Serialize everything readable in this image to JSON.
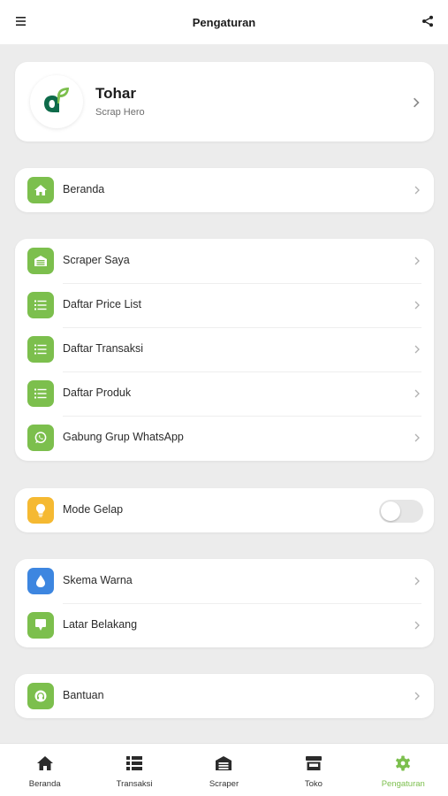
{
  "header": {
    "title": "Pengaturan",
    "menu_icon": "hamburger-menu-icon",
    "share_icon": "share-icon"
  },
  "profile": {
    "name": "Tohar",
    "subtitle": "Scrap Hero",
    "logo_icon": "app-leaf-logo"
  },
  "sections": {
    "home": {
      "label": "Beranda",
      "icon": "home-icon"
    },
    "lists": [
      {
        "label": "Scraper Saya",
        "icon": "warehouse-icon"
      },
      {
        "label": "Daftar Price List",
        "icon": "list-icon"
      },
      {
        "label": "Daftar Transaksi",
        "icon": "list-icon"
      },
      {
        "label": "Daftar Produk",
        "icon": "list-icon"
      },
      {
        "label": "Gabung Grup WhatsApp",
        "icon": "whatsapp-icon"
      }
    ],
    "dark_mode": {
      "label": "Mode Gelap",
      "icon": "lightbulb-icon",
      "enabled": false
    },
    "appearance": [
      {
        "label": "Skema Warna",
        "icon": "droplet-icon"
      },
      {
        "label": "Latar Belakang",
        "icon": "background-icon"
      }
    ],
    "help": {
      "label": "Bantuan",
      "icon": "headset-icon"
    }
  },
  "bottom_nav": {
    "items": [
      {
        "label": "Beranda",
        "icon": "home-icon",
        "active": false
      },
      {
        "label": "Transaksi",
        "icon": "list-icon",
        "active": false
      },
      {
        "label": "Scraper",
        "icon": "warehouse-icon",
        "active": false
      },
      {
        "label": "Toko",
        "icon": "store-icon",
        "active": false
      },
      {
        "label": "Pengaturan",
        "icon": "gear-icon",
        "active": true
      }
    ]
  },
  "colors": {
    "accent_green": "#7cbf4d",
    "dark_green": "#0e6b4a",
    "mode_yellow": "#f5b932",
    "color_scheme_blue": "#3d86e0",
    "page_background": "#ececec"
  }
}
